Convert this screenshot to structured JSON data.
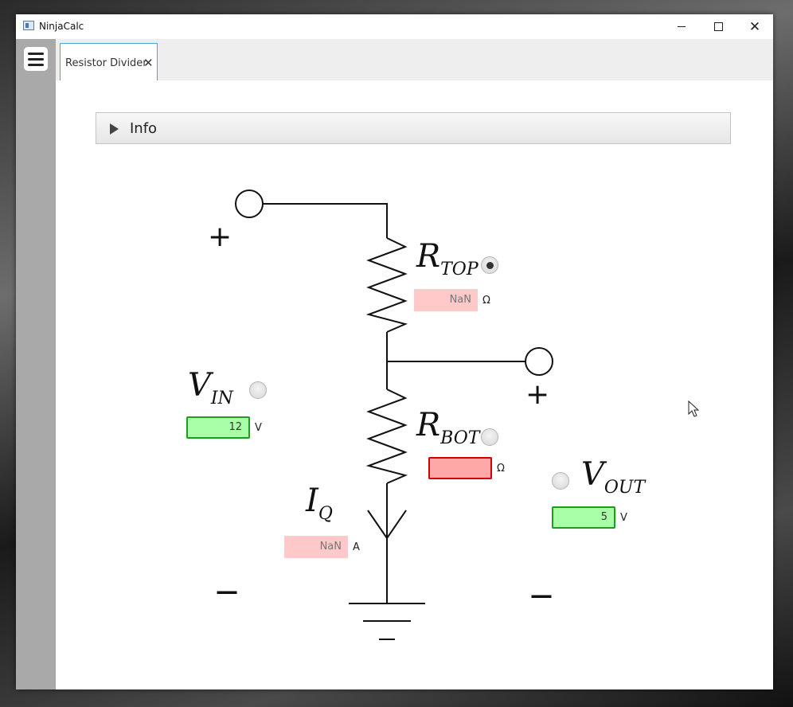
{
  "window": {
    "title": "NinjaCalc",
    "icon": "app-window-icon",
    "controls": {
      "minimize": "minimize-icon",
      "maximize": "maximize-icon",
      "close": "✕"
    }
  },
  "tabs": [
    {
      "label": "Resistor Divider",
      "close": "✕"
    }
  ],
  "info": {
    "label": "Info"
  },
  "circuit": {
    "r_top": {
      "symbol": "R",
      "subscript": "TOP",
      "value": "NaN",
      "unit": "Ω",
      "selected": true
    },
    "r_bot": {
      "symbol": "R",
      "subscript": "BOT",
      "value": "",
      "unit": "Ω",
      "selected": false
    },
    "v_in": {
      "symbol": "V",
      "subscript": "IN",
      "value": "12",
      "unit": "V",
      "selected": false
    },
    "v_out": {
      "symbol": "V",
      "subscript": "OUT",
      "value": "5",
      "unit": "V",
      "selected": false
    },
    "i_q": {
      "symbol": "I",
      "subscript": "Q",
      "value": "NaN",
      "unit": "A"
    },
    "plus_sign": "+",
    "minus_sign": "—"
  },
  "colors": {
    "valid_field": "#a8ffa8",
    "invalid_field": "#ffa8a8",
    "calculated_field": "#ffc9c9",
    "tab_border": "#49a6d8"
  }
}
